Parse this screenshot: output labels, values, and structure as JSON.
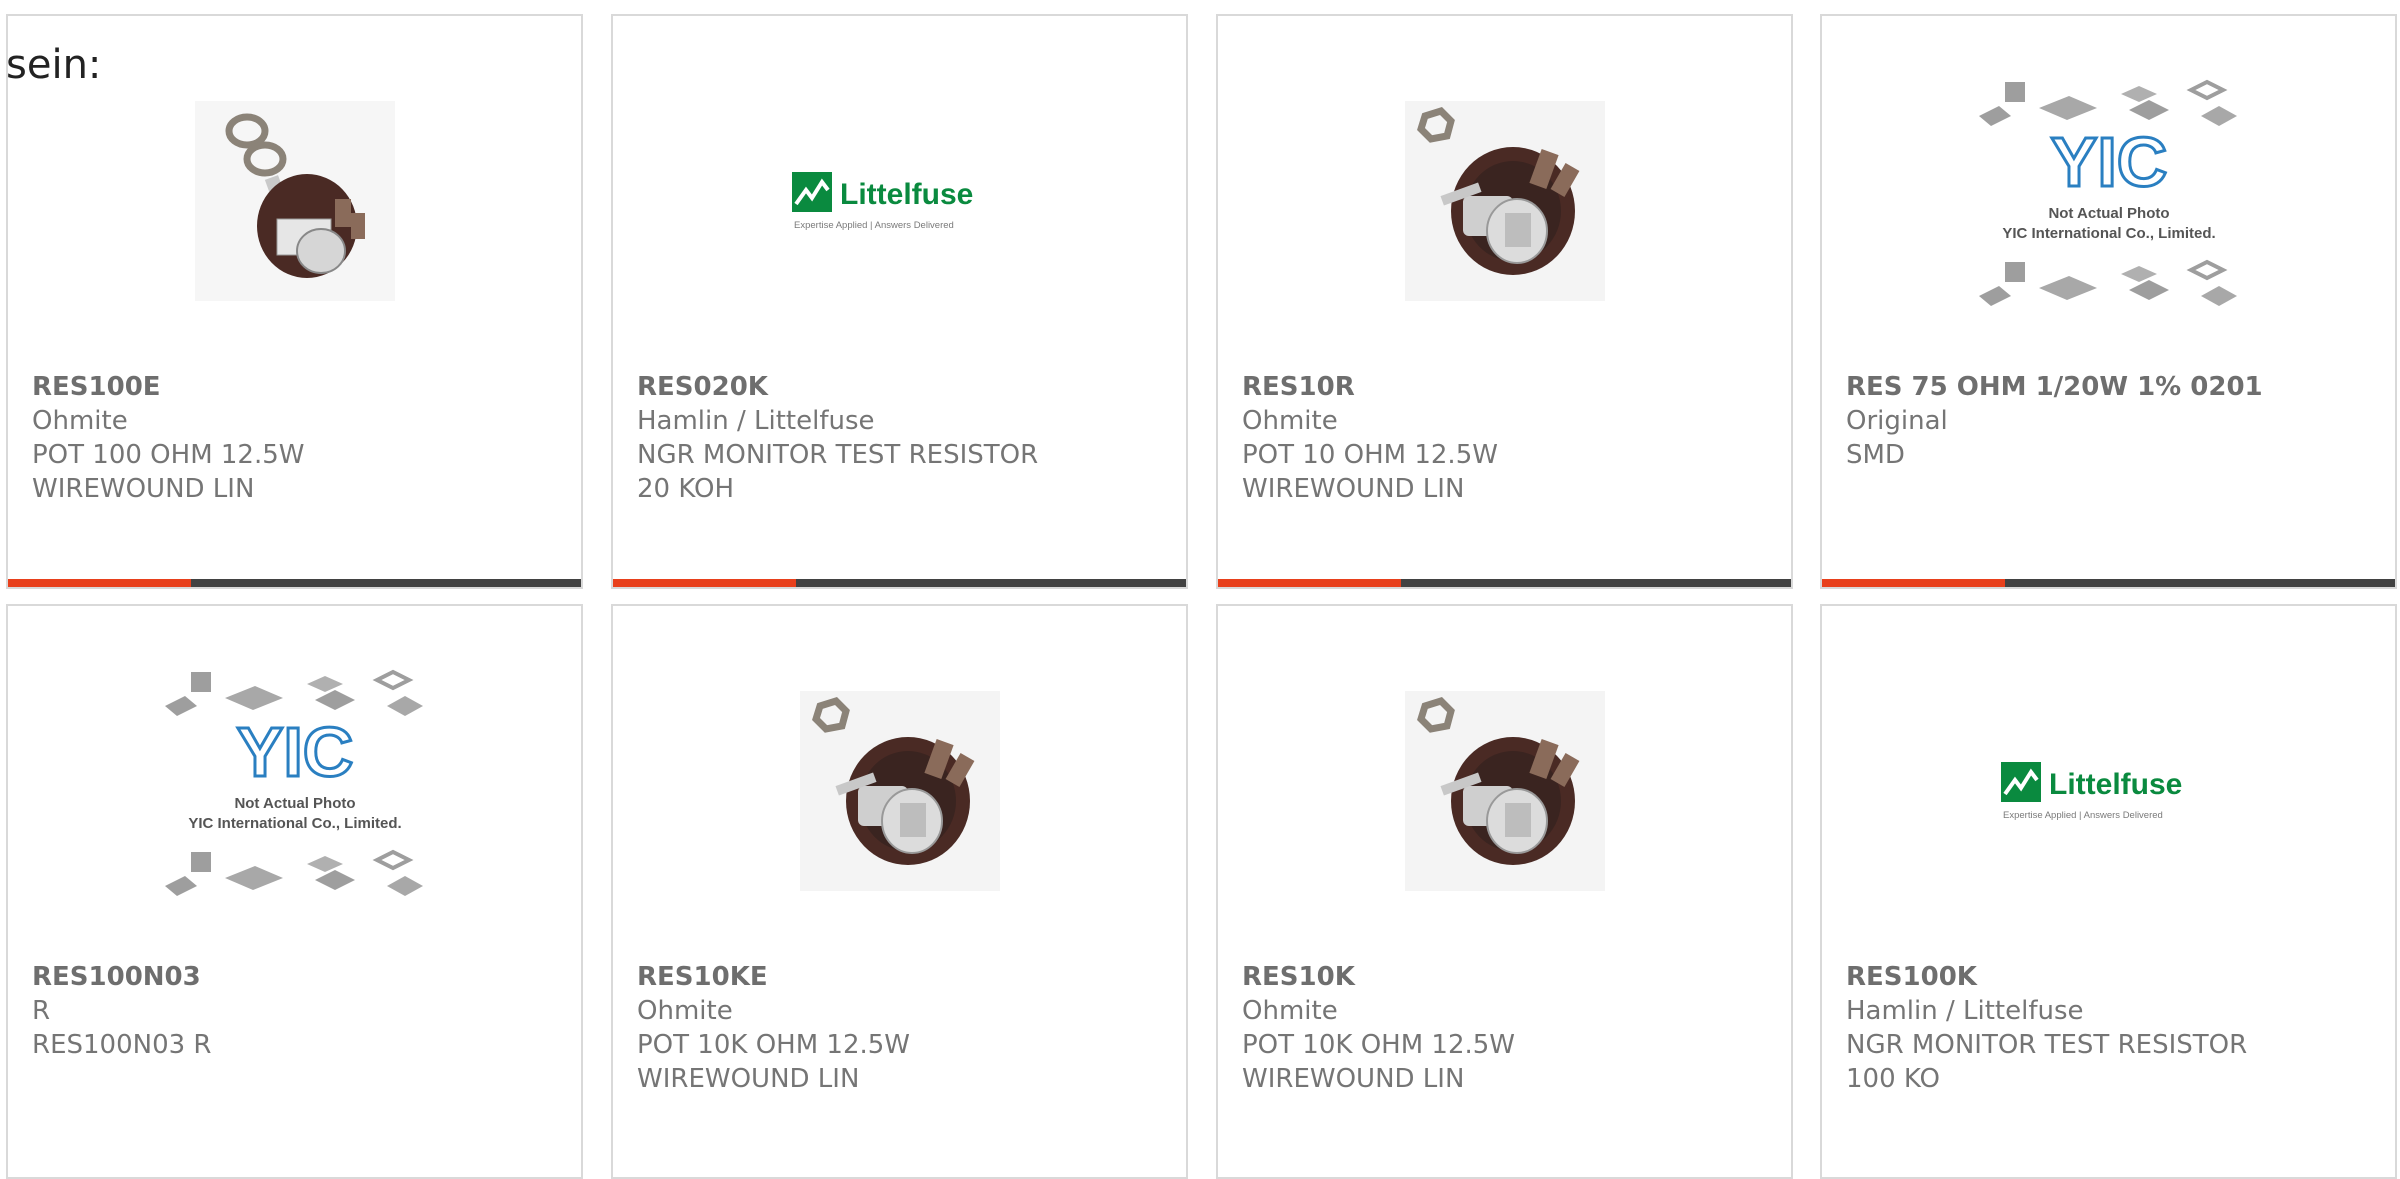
{
  "page": {
    "lead_text": "sein:"
  },
  "colors": {
    "accent": "#e8401c",
    "bar": "#424242",
    "text": "#757575",
    "border": "#d9d9d9",
    "littelfuse_green": "#0a8a3f",
    "yic_blue": "#2a7fc1"
  },
  "products": [
    {
      "part_number": "RES100E",
      "manufacturer": "Ohmite",
      "desc1": "POT 100 OHM 12.5W",
      "desc2": "WIREWOUND LIN",
      "image": "potentiometer-with-nuts"
    },
    {
      "part_number": "RES020K",
      "manufacturer": "Hamlin / Littelfuse",
      "desc1": "NGR MONITOR TEST RESISTOR",
      "desc2": "20 KOH",
      "image": "littelfuse-logo"
    },
    {
      "part_number": "RES10R",
      "manufacturer": "Ohmite",
      "desc1": "POT 10 OHM 12.5W",
      "desc2": "WIREWOUND LIN",
      "image": "potentiometer"
    },
    {
      "part_number": "RES 75 OHM 1/20W 1% 0201",
      "manufacturer": "Original",
      "desc1": "SMD",
      "desc2": "",
      "image": "yic-placeholder"
    },
    {
      "part_number": "RES100N03",
      "manufacturer": "R",
      "desc1": "RES100N03 R",
      "desc2": "",
      "image": "yic-placeholder"
    },
    {
      "part_number": "RES10KE",
      "manufacturer": "Ohmite",
      "desc1": "POT 10K OHM 12.5W",
      "desc2": "WIREWOUND LIN",
      "image": "potentiometer"
    },
    {
      "part_number": "RES10K",
      "manufacturer": "Ohmite",
      "desc1": "POT 10K OHM 12.5W",
      "desc2": "WIREWOUND LIN",
      "image": "potentiometer"
    },
    {
      "part_number": "RES100K",
      "manufacturer": "Hamlin / Littelfuse",
      "desc1": "NGR MONITOR TEST RESISTOR",
      "desc2": "100 KO",
      "image": "littelfuse-logo"
    }
  ],
  "logos": {
    "littelfuse": {
      "name": "Littelfuse",
      "tagline": "Expertise Applied | Answers Delivered"
    },
    "yic": {
      "line1": "Not Actual Photo",
      "line2": "YIC International Co., Limited."
    }
  }
}
